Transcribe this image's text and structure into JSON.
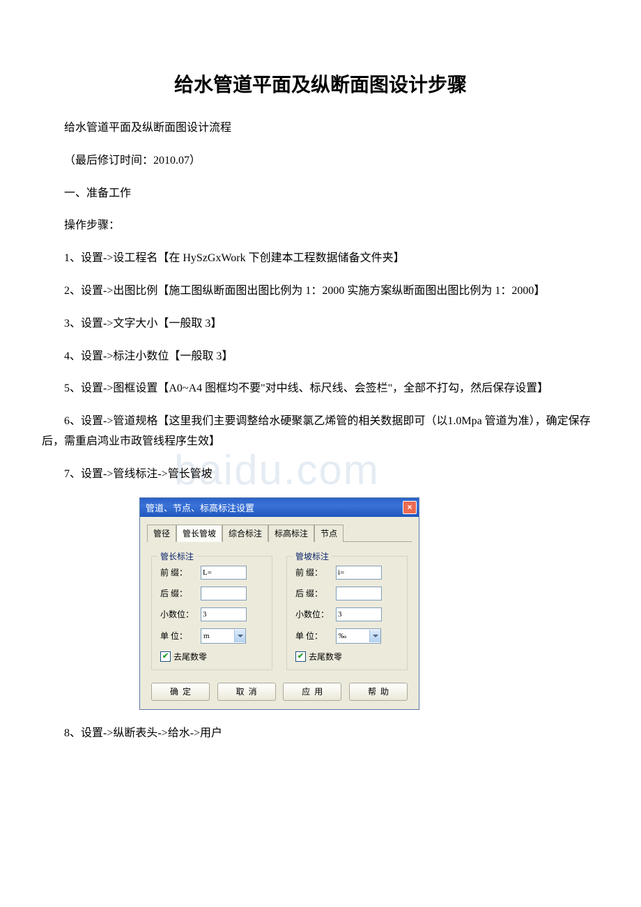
{
  "title": "给水管道平面及纵断面图设计步骤",
  "intro": "给水管道平面及纵断面图设计流程",
  "revised": "（最后修订时间：2010.07）",
  "section1": "一、准备工作",
  "ops_label": "操作步骤：",
  "steps": {
    "s1": "1、设置->设工程名【在 HySzGxWork 下创建本工程数据储备文件夹】",
    "s2": "2、设置->出图比例【施工图纵断面图出图比例为 1：2000 实施方案纵断面图出图比例为 1：2000】",
    "s3": "3、设置->文字大小【一般取 3】",
    "s4": "4、设置->标注小数位【一般取 3】",
    "s5": "5、设置->图框设置【A0~A4 图框均不要\"对中线、标尺线、会签栏\"，全部不打勾，然后保存设置】",
    "s6": "6、设置->管道规格【这里我们主要调整给水硬聚氯乙烯管的相关数据即可（以1.0Mpa 管道为准），确定保存后，需重启鸿业市政管线程序生效】",
    "s7": "7、设置->管线标注->管长管坡",
    "s8": "8、设置->纵断表头->给水->用户"
  },
  "watermark": "baidu.com",
  "dialog": {
    "title": "管道、节点、标高标注设置",
    "tabs": [
      "管径",
      "管长管坡",
      "综合标注",
      "标高标注",
      "节点"
    ],
    "group1": {
      "title": "管长标注",
      "prefix_label": "前 缀：",
      "prefix_value": "L=",
      "suffix_label": "后 缀：",
      "suffix_value": "",
      "decimal_label": "小数位：",
      "decimal_value": "3",
      "unit_label": "单 位：",
      "unit_value": "m",
      "trim_label": "去尾数零"
    },
    "group2": {
      "title": "管坡标注",
      "prefix_label": "前 缀：",
      "prefix_value": "i=",
      "suffix_label": "后 缀：",
      "suffix_value": "",
      "decimal_label": "小数位：",
      "decimal_value": "3",
      "unit_label": "单 位：",
      "unit_value": "‰",
      "trim_label": "去尾数零"
    },
    "buttons": {
      "ok": "确定",
      "cancel": "取消",
      "apply": "应用",
      "help": "帮助"
    }
  }
}
